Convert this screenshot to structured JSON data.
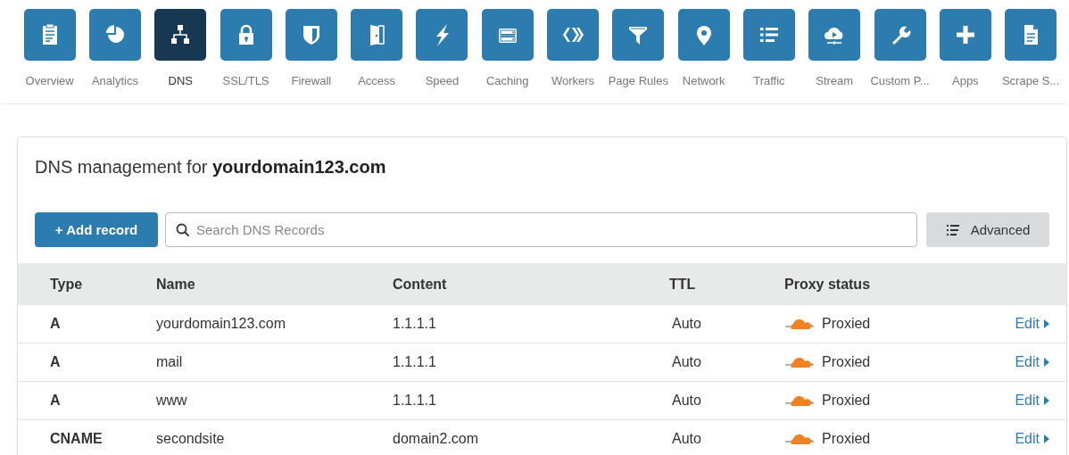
{
  "nav_tabs": [
    {
      "label": "Overview",
      "selected": false
    },
    {
      "label": "Analytics",
      "selected": false
    },
    {
      "label": "DNS",
      "selected": true
    },
    {
      "label": "SSL/TLS",
      "selected": false
    },
    {
      "label": "Firewall",
      "selected": false
    },
    {
      "label": "Access",
      "selected": false
    },
    {
      "label": "Speed",
      "selected": false
    },
    {
      "label": "Caching",
      "selected": false
    },
    {
      "label": "Workers",
      "selected": false
    },
    {
      "label": "Page Rules",
      "selected": false
    },
    {
      "label": "Network",
      "selected": false
    },
    {
      "label": "Traffic",
      "selected": false
    },
    {
      "label": "Stream",
      "selected": false
    },
    {
      "label": "Custom P...",
      "selected": false
    },
    {
      "label": "Apps",
      "selected": false
    },
    {
      "label": "Scrape S...",
      "selected": false
    }
  ],
  "panel": {
    "title": "DNS management for **yourdomain123.com**",
    "add_button": "+ Add record",
    "search": {
      "placeholder": "Search DNS Records"
    },
    "advanced_button": "Advanced",
    "table": {
      "columns": [
        "Type",
        "Name",
        "Content",
        "TTL",
        "Proxy status"
      ],
      "rows": [
        {
          "type": "A",
          "name": "yourdomain123.com",
          "content": "1.1.1.1",
          "ttl": "Auto",
          "proxied": true,
          "proxy_status": "Proxied",
          "action": "Edit"
        },
        {
          "type": "A",
          "name": "mail",
          "content": "1.1.1.1",
          "ttl": "Auto",
          "proxied": true,
          "proxy_status": "Proxied",
          "action": "Edit"
        },
        {
          "type": "A",
          "name": "www",
          "content": "1.1.1.1",
          "ttl": "Auto",
          "proxied": true,
          "proxy_status": "Proxied",
          "action": "Edit"
        },
        {
          "type": "CNAME",
          "name": "secondsite",
          "content": "domain2.com",
          "ttl": "Auto",
          "proxied": true,
          "proxy_status": "Proxied",
          "action": "Edit"
        }
      ]
    }
  }
}
